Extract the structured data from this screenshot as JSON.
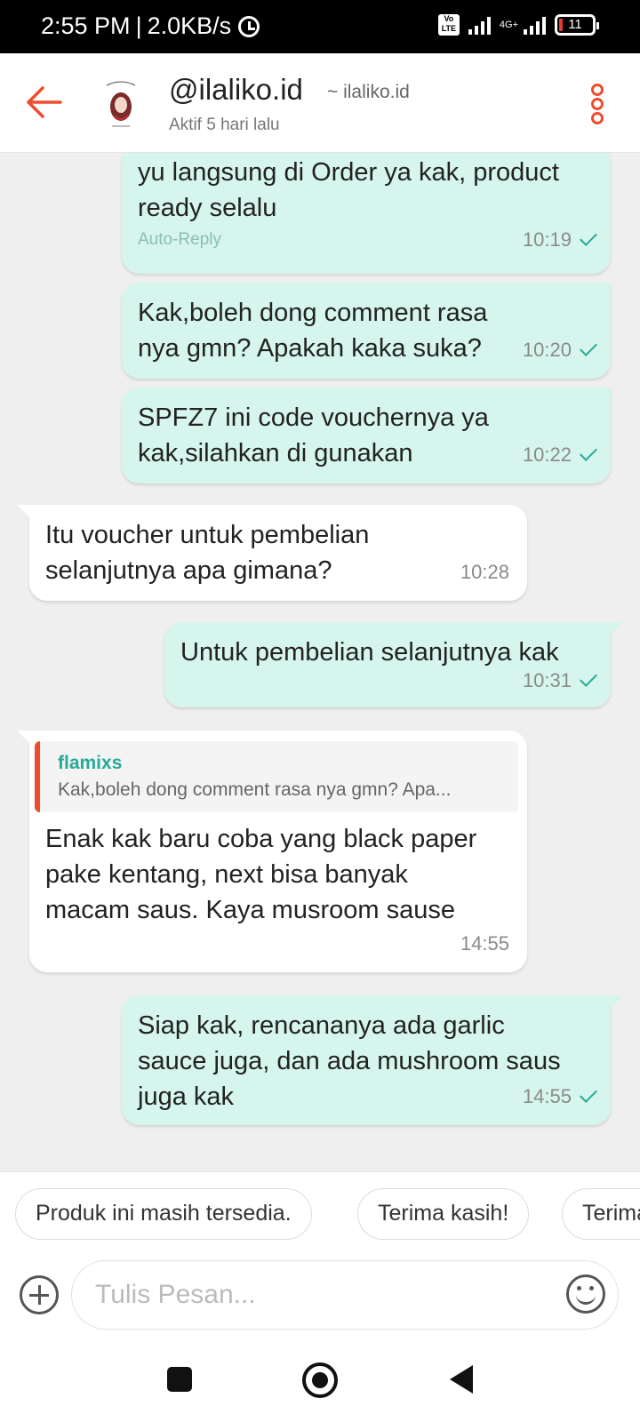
{
  "status_bar": {
    "time": "2:55 PM",
    "speed": "2.0KB/s",
    "volte": "Vo LTE",
    "network": "4G+",
    "battery": "11"
  },
  "header": {
    "username": "@ilaliko.id",
    "shop_name": "~ ilaliko.id",
    "status": "Aktif 5 hari lalu",
    "accent_color": "#ee4d2d"
  },
  "messages": [
    {
      "side": "out",
      "text": "yu langsung di Order ya kak, product ready selalu",
      "label": "Auto-Reply",
      "time": "10:19",
      "read": true
    },
    {
      "side": "out",
      "text": "Kak,boleh dong comment rasa nya gmn? Apakah kaka suka?",
      "time": "10:20",
      "read": true
    },
    {
      "side": "out",
      "text": "SPFZ7 ini code vouchernya ya kak,silahkan di gunakan",
      "time": "10:22",
      "read": true
    },
    {
      "side": "in",
      "text": "Itu voucher untuk pembelian selanjutnya apa gimana?",
      "time": "10:28"
    },
    {
      "side": "out",
      "text": "Untuk pembelian selanjutnya kak",
      "time": "10:31",
      "read": true
    },
    {
      "side": "in",
      "quote_user": "flamixs",
      "quote_text": "Kak,boleh dong comment rasa nya gmn? Apa...",
      "text": "Enak kak baru coba yang black paper pake kentang, next bisa banyak macam saus. Kaya musroom sause",
      "time": "14:55"
    },
    {
      "side": "out",
      "text": "Siap kak, rencananya ada garlic sauce juga, dan ada mushroom saus juga kak",
      "time": "14:55",
      "read": true
    }
  ],
  "quick_replies": [
    "Produk ini masih tersedia.",
    "Terima kasih!",
    "Terima kasih"
  ],
  "input": {
    "placeholder": "Tulis Pesan..."
  }
}
